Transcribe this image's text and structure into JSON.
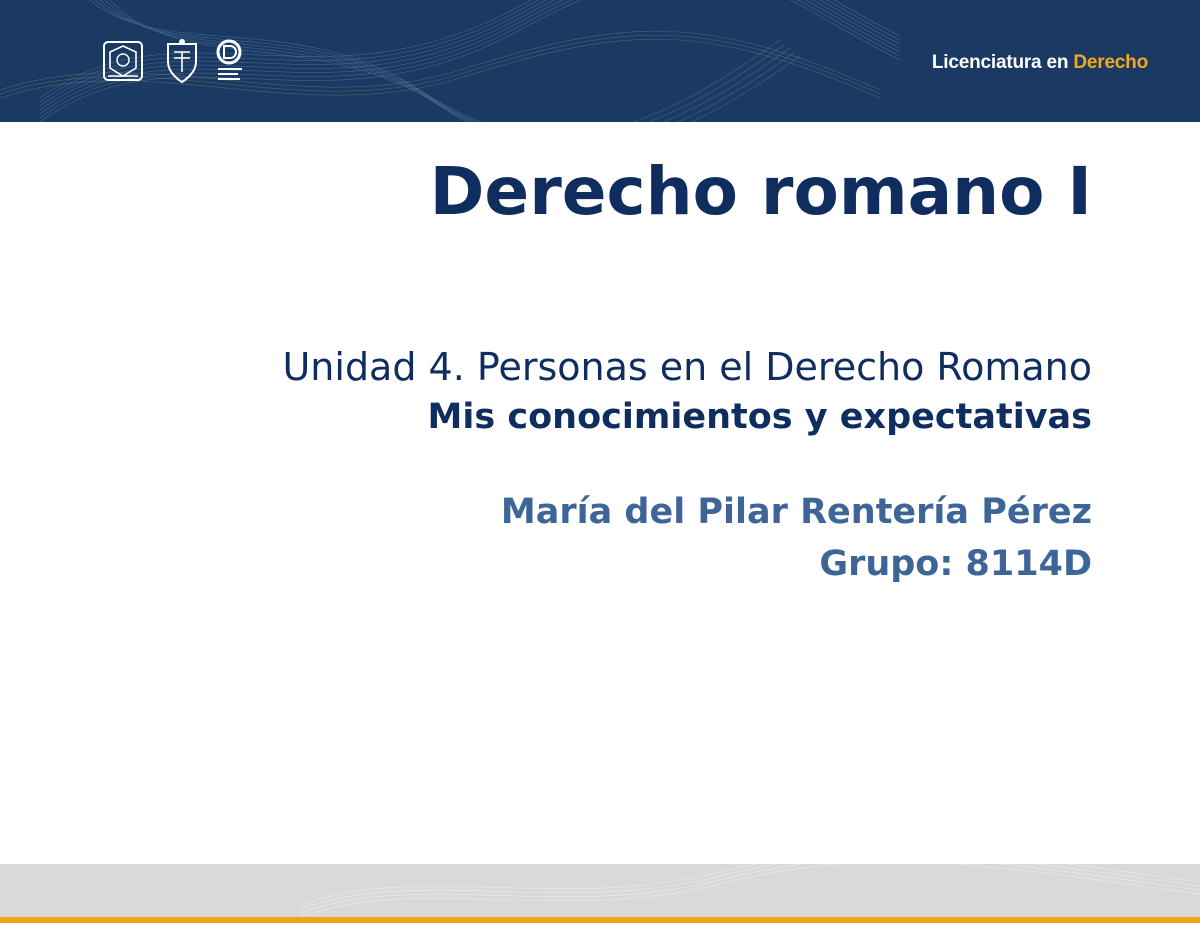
{
  "header": {
    "program_prefix": "Licenciatura en ",
    "program_accent": "Derecho",
    "background_color": "#1a3a63",
    "accent_color": "#f2a81d",
    "logos": [
      "unam-seal-icon",
      "fes-shield-icon",
      "cuaed-logo-icon"
    ]
  },
  "main": {
    "course_title": "Derecho romano I",
    "unit": "Unidad 4. Personas en el Derecho Romano",
    "activity": "Mis conocimientos y expectativas",
    "student": "María del Pilar Rentería Pérez",
    "group": "Grupo: 8114D"
  },
  "colors": {
    "title": "#0f2d5e",
    "student": "#3d6597",
    "footer_band": "#d9d9d9",
    "footer_line": "#efa51a"
  }
}
